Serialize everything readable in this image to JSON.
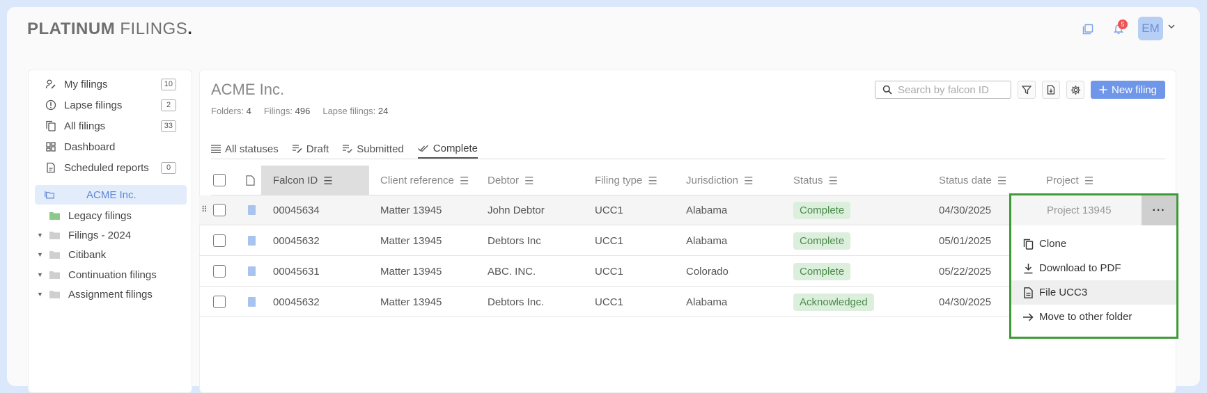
{
  "app": {
    "logo_bold": "PLATINUM",
    "logo_light": "FILINGS",
    "logo_dot": ".",
    "notification_count": "5",
    "user_initials": "EM"
  },
  "sidebar": {
    "items": [
      {
        "label": "My filings",
        "count": "10",
        "icon": "user-edit-icon"
      },
      {
        "label": "Lapse filings",
        "count": "2",
        "icon": "alert-circle-icon"
      },
      {
        "label": "All filings",
        "count": "33",
        "icon": "copy-icon"
      },
      {
        "label": "Dashboard",
        "count": "",
        "icon": "dashboard-icon"
      },
      {
        "label": "Scheduled reports",
        "count": "0",
        "icon": "report-icon"
      }
    ],
    "active_folder": "ACME Inc.",
    "subfolders": [
      {
        "label": "Legacy filings",
        "icon": "folder-green-icon",
        "expandable": false
      },
      {
        "label": "Filings - 2024",
        "icon": "folder-icon",
        "expandable": true
      },
      {
        "label": "Citibank",
        "icon": "folder-icon",
        "expandable": false
      },
      {
        "label": "Continuation filings",
        "icon": "folder-icon",
        "expandable": true
      },
      {
        "label": "Assignment filings",
        "icon": "folder-icon",
        "expandable": true
      }
    ]
  },
  "main": {
    "title": "ACME Inc.",
    "stats": [
      {
        "label": "Folders:",
        "value": "4"
      },
      {
        "label": "Filings:",
        "value": "496"
      },
      {
        "label": "Lapse filings:",
        "value": "24"
      }
    ],
    "search_placeholder": "Search by falcon ID",
    "new_filing_label": "New filing",
    "tabs": [
      {
        "label": "All statuses",
        "active": false
      },
      {
        "label": "Draft",
        "active": false
      },
      {
        "label": "Submitted",
        "active": false
      },
      {
        "label": "Complete",
        "active": true
      }
    ],
    "columns": [
      "Falcon ID",
      "Client reference",
      "Debtor",
      "Filing type",
      "Jurisdiction",
      "Status",
      "Status date",
      "Project"
    ],
    "rows": [
      {
        "falcon_id": "00045634",
        "client_ref": "Matter 13945",
        "debtor": "John Debtor",
        "filing_type": "UCC1",
        "jurisdiction": "Alabama",
        "status": "Complete",
        "status_date": "04/30/2025",
        "project": "Project 13945"
      },
      {
        "falcon_id": "00045632",
        "client_ref": "Matter 13945",
        "debtor": "Debtors Inc",
        "filing_type": "UCC1",
        "jurisdiction": "Alabama",
        "status": "Complete",
        "status_date": "05/01/2025",
        "project": ""
      },
      {
        "falcon_id": "00045631",
        "client_ref": "Matter 13945",
        "debtor": "ABC. INC.",
        "filing_type": "UCC1",
        "jurisdiction": "Colorado",
        "status": "Complete",
        "status_date": "05/22/2025",
        "project": ""
      },
      {
        "falcon_id": "00045632",
        "client_ref": "Matter 13945",
        "debtor": "Debtors Inc.",
        "filing_type": "UCC1",
        "jurisdiction": "Alabama",
        "status": "Acknowledged",
        "status_date": "04/30/2025",
        "project": ""
      }
    ]
  },
  "context_menu": {
    "more_label": "···",
    "items": [
      {
        "label": "Clone",
        "icon": "clone-icon"
      },
      {
        "label": "Download to PDF",
        "icon": "download-icon"
      },
      {
        "label": "File UCC3",
        "icon": "file-icon"
      },
      {
        "label": "Move to other folder",
        "icon": "arrow-right-icon"
      }
    ]
  },
  "colors": {
    "accent": "#6f96e8",
    "status_green_bg": "#dcefdc",
    "highlight_border": "#3d9a37"
  }
}
